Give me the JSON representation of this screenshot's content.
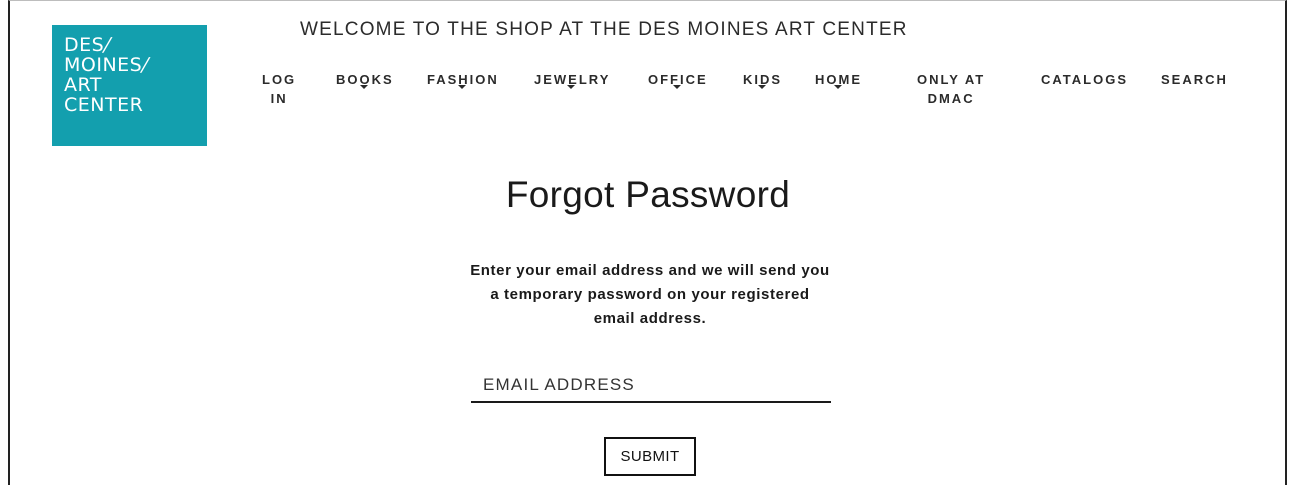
{
  "logo": {
    "lines": [
      "DES",
      "MOINES",
      "ART",
      "CENTER"
    ],
    "bg_color": "#139fae"
  },
  "header": {
    "welcome": "WELCOME TO THE SHOP AT THE DES MOINES ART CENTER"
  },
  "nav": {
    "items": [
      {
        "line1": "LOG",
        "line2": "IN",
        "dropdown": false
      },
      {
        "line1": "BOOKS",
        "line2": "",
        "dropdown": true
      },
      {
        "line1": "FASHION",
        "line2": "",
        "dropdown": true
      },
      {
        "line1": "JEWELRY",
        "line2": "",
        "dropdown": true
      },
      {
        "line1": "OFFICE",
        "line2": "",
        "dropdown": true
      },
      {
        "line1": "KIDS",
        "line2": "",
        "dropdown": true
      },
      {
        "line1": "HOME",
        "line2": "",
        "dropdown": true
      },
      {
        "line1": "ONLY AT",
        "line2": "DMAC",
        "dropdown": false
      },
      {
        "line1": "CATALOGS",
        "line2": "",
        "dropdown": false
      },
      {
        "line1": "SEARCH",
        "line2": "",
        "dropdown": false
      }
    ]
  },
  "main": {
    "title": "Forgot Password",
    "instructions": "Enter your email address and we will send you a temporary password on your registered email address.",
    "email_placeholder": "EMAIL ADDRESS",
    "email_value": "",
    "submit_label": "SUBMIT"
  }
}
